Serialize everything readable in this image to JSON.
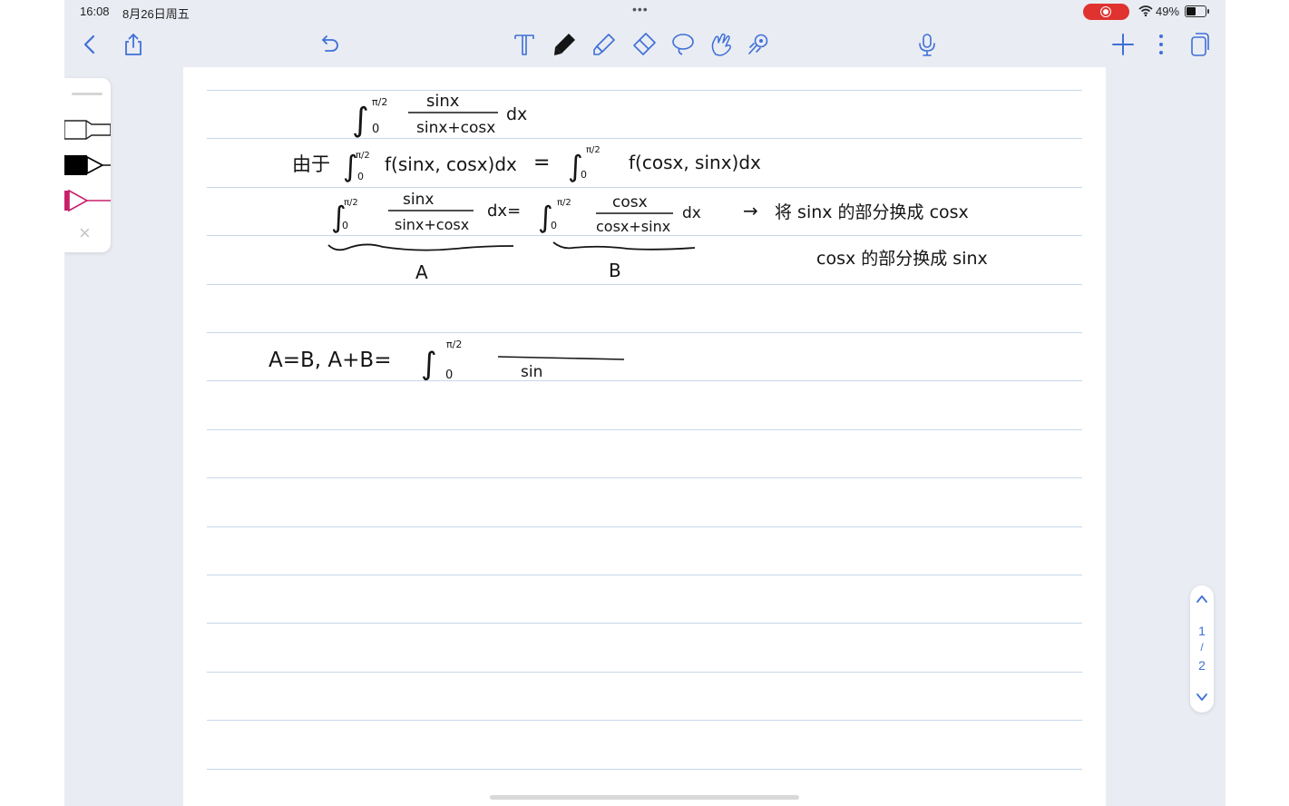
{
  "status_bar": {
    "time": "16:08",
    "date": "8月26日周五",
    "battery_percent": "49%",
    "battery_level": 0.49,
    "recording": true
  },
  "toolbar": {
    "left": [
      "back-icon",
      "share-icon",
      "undo-icon"
    ],
    "center": [
      "text-tool-icon",
      "pen-tool-icon",
      "highlighter-tool-icon",
      "eraser-tool-icon",
      "lasso-tool-icon",
      "shapes-tool-icon",
      "laser-pointer-icon"
    ],
    "right": [
      "microphone-icon",
      "add-icon",
      "more-icon",
      "pages-icon"
    ]
  },
  "pen_palette": {
    "pens": [
      {
        "name": "pen-outline",
        "color": "#ffffff",
        "selected": false
      },
      {
        "name": "pen-black",
        "color": "#000000",
        "selected": true
      },
      {
        "name": "pen-magenta",
        "color": "#c8206a",
        "selected": false
      }
    ]
  },
  "page": {
    "ruled_lines": 15,
    "handwriting": {
      "line1": {
        "integral": "∫",
        "upper": "π/2",
        "lower": "0",
        "numerator": "sinx",
        "denominator": "sinx+cosx",
        "differential": "dx"
      },
      "line2": {
        "prefix": "由于",
        "integral": "∫",
        "upper": "π/2",
        "lower": "0",
        "left_integrand": "f(sinx, cosx)dx",
        "equals": "=",
        "right_integrand": "f(cosx, sinx)dx"
      },
      "line3": {
        "left_num": "sinx",
        "left_den": "sinx+cosx",
        "mid": "dx=",
        "right_num": "cosx",
        "right_den": "cosx+sinx",
        "right_dx": "dx",
        "note_arrow": "→",
        "note_line1": "将 sinx 的部分换成 cosx",
        "note_line2": "cosx 的部分换成 sinx"
      },
      "labels": {
        "a": "A",
        "b": "B"
      },
      "line5": {
        "text": "A=B,   A+B=",
        "integral": "∫",
        "upper": "π/2",
        "lower": "0",
        "denominator_partial": "sin"
      }
    }
  },
  "pager": {
    "current": "1",
    "separator": "/",
    "total": "2"
  }
}
